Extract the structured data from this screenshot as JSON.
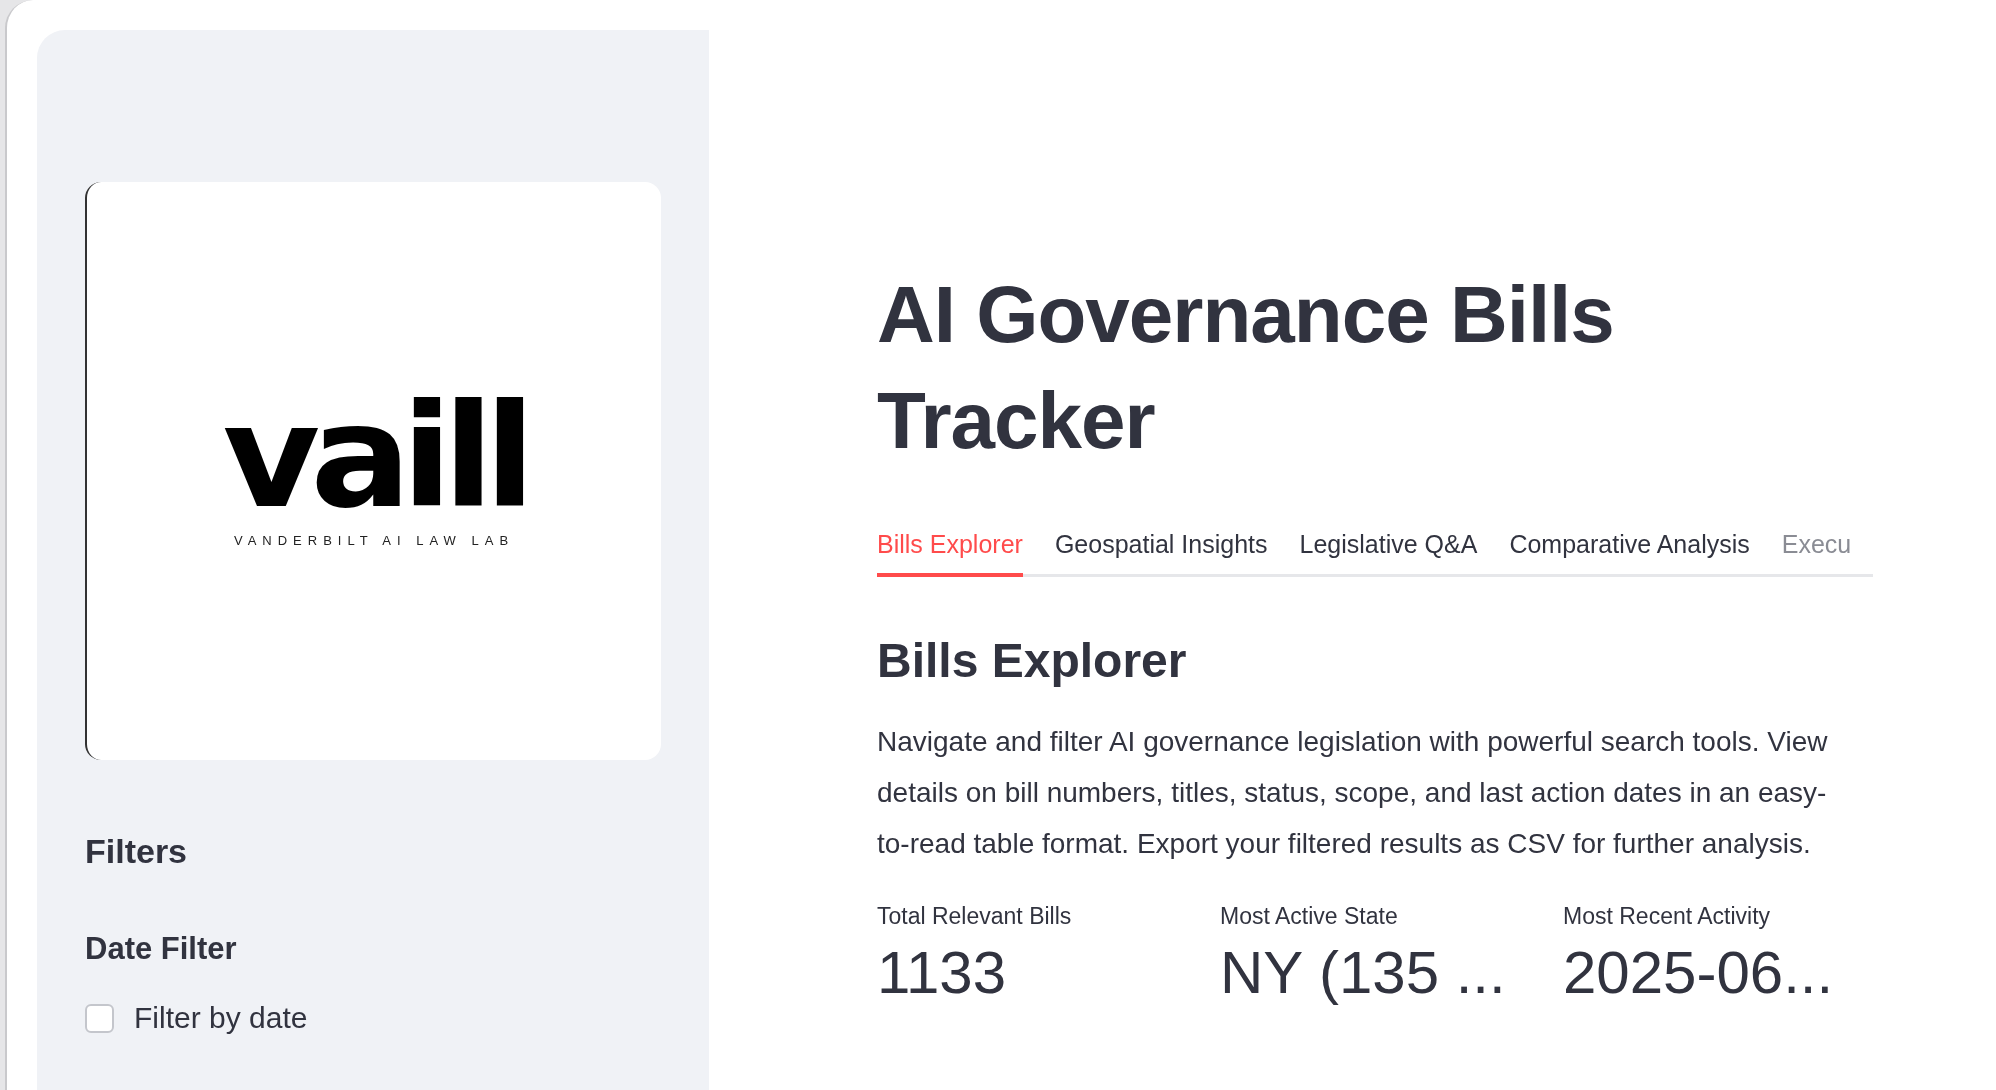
{
  "sidebar": {
    "logo": {
      "wordmark": "vaill",
      "tagline": "VANDERBILT AI LAW LAB"
    },
    "heading": "Filters",
    "date_filter": {
      "label": "Date Filter",
      "checkbox": {
        "label": "Filter by date",
        "checked": false
      }
    }
  },
  "main": {
    "title": "AI Governance Bills Tracker",
    "tabs": [
      {
        "label": "Bills Explorer",
        "selected": true
      },
      {
        "label": "Geospatial Insights",
        "selected": false
      },
      {
        "label": "Legislative Q&A",
        "selected": false
      },
      {
        "label": "Comparative Analysis",
        "selected": false
      },
      {
        "label": "Execu",
        "selected": false
      }
    ],
    "section_title": "Bills Explorer",
    "description": "Navigate and filter AI governance legislation with powerful search tools. View details on bill numbers, titles, status, scope, and last action dates in an easy-to-read table format. Export your filtered results as CSV for further analysis.",
    "metrics": [
      {
        "label": "Total Relevant Bills",
        "value": "1133"
      },
      {
        "label": "Most Active State",
        "value": "NY (135 ..."
      },
      {
        "label": "Most Recent Activity",
        "value": "2025-06..."
      }
    ]
  }
}
